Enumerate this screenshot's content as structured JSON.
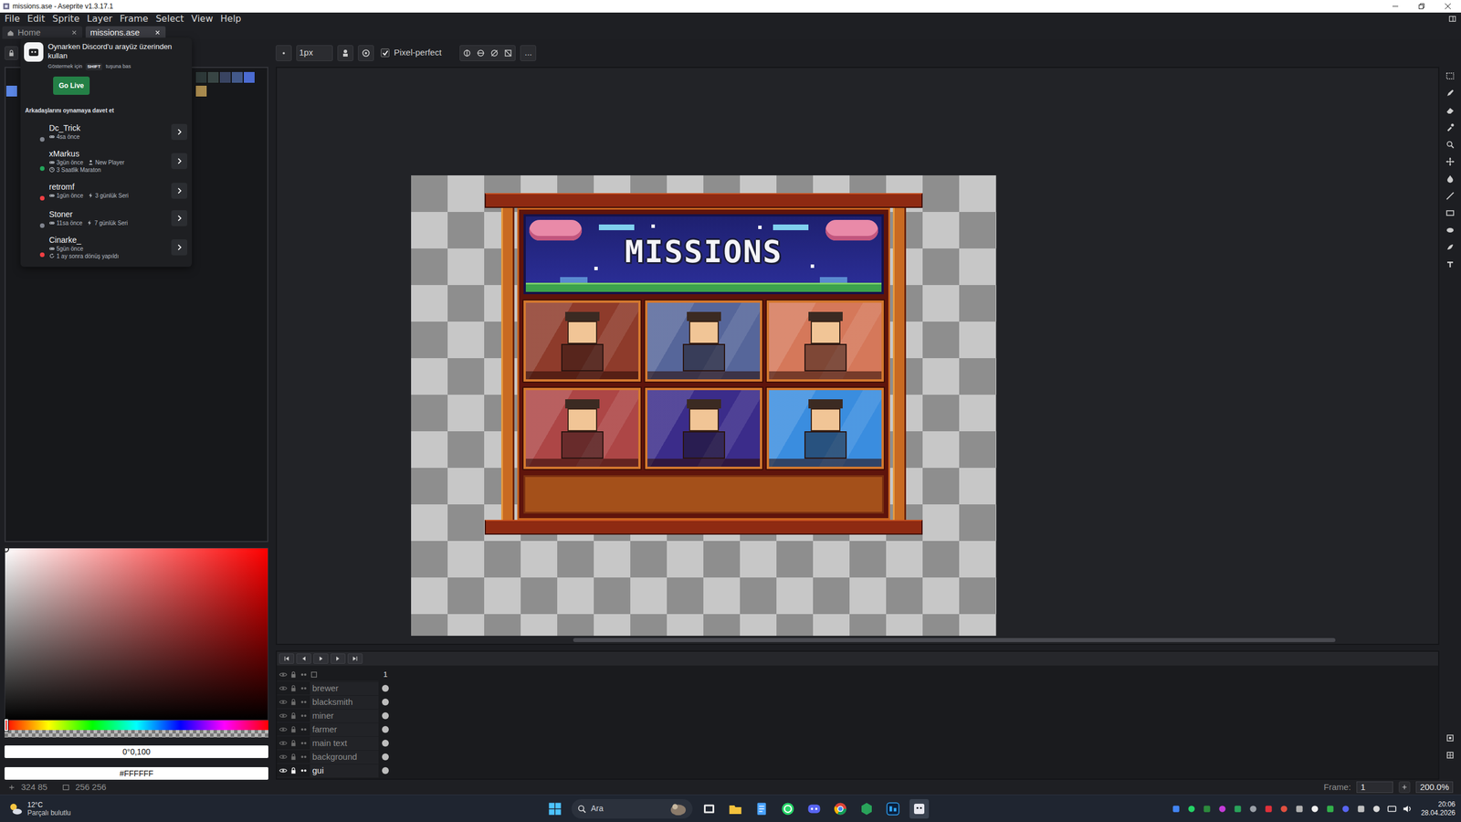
{
  "window": {
    "title": "missions.ase - Aseprite v1.3.17.1"
  },
  "menu": [
    "File",
    "Edit",
    "Sprite",
    "Layer",
    "Frame",
    "Select",
    "View",
    "Help"
  ],
  "tabs": [
    {
      "label": "Home",
      "selected": false
    },
    {
      "label": "missions.ase",
      "selected": true
    }
  ],
  "toolbar": {
    "brush_size": "1px",
    "pixel_perfect": {
      "label": "Pixel-perfect",
      "checked": true
    },
    "more": "..."
  },
  "palette": {
    "row1": [
      {
        "color": "#2d3838"
      },
      {
        "color": "#384544"
      },
      {
        "color": "#394461"
      },
      {
        "color": "#43598a"
      },
      {
        "color": "#4b6bd1"
      }
    ],
    "row2": [
      {
        "color": "#5b86e5"
      },
      {
        "color": "#a88a4e"
      }
    ]
  },
  "color": {
    "hue": 0,
    "hsv": "0°0,100",
    "hex": "#FFFFFF"
  },
  "sprite": {
    "banner": "MISSIONS",
    "cells": [
      {
        "color": "#8e3b2b"
      },
      {
        "color": "#56669a"
      },
      {
        "color": "#d5785a"
      },
      {
        "color": "#ad4646"
      },
      {
        "color": "#3b2c8a"
      },
      {
        "color": "#3a8ddf"
      }
    ]
  },
  "timeline": {
    "frame": "1",
    "layers": [
      {
        "name": "brewer",
        "selected": false
      },
      {
        "name": "blacksmith",
        "selected": false
      },
      {
        "name": "miner",
        "selected": false
      },
      {
        "name": "farmer",
        "selected": false
      },
      {
        "name": "main text",
        "selected": false
      },
      {
        "name": "background",
        "selected": false
      },
      {
        "name": "gui",
        "selected": true
      }
    ]
  },
  "status_bar": {
    "position": "324 85",
    "size": "256 256",
    "frame_label": "Frame:",
    "frame": "1",
    "zoom": "200.0%"
  },
  "overlay": {
    "title": "Oynarken Discord'u arayüz üzerinden kullan",
    "hint": {
      "before": "Göstermek için",
      "key": "SHIFT",
      "after": "tuşuna bas"
    },
    "go_live": "Go Live",
    "invite_title": "Arkadaşlarını oynamaya davet et",
    "friends": [
      {
        "name": "Dc_Trick",
        "avatar_color": "#8d8f7c",
        "status_color": "#80848e",
        "lines": [
          [
            {
              "kind": "played",
              "text": "4sa önce"
            }
          ]
        ]
      },
      {
        "name": "xMarkus",
        "avatar_color": "#e8a23c",
        "status_color": "#23a55a",
        "lines": [
          [
            {
              "kind": "played",
              "text": "3gün önce"
            },
            {
              "kind": "player",
              "text": "New Player"
            }
          ],
          [
            {
              "kind": "event",
              "text": "3 Saatlik Maraton"
            }
          ]
        ]
      },
      {
        "name": "retromf",
        "avatar_color": "#3a4a7a",
        "status_color": "#f23f43",
        "lines": [
          [
            {
              "kind": "played",
              "text": "1gün önce"
            },
            {
              "kind": "streak",
              "text": "3 günlük Seri"
            }
          ]
        ]
      },
      {
        "name": "Stoner",
        "avatar_color": "#3c3c3c",
        "status_color": "#80848e",
        "lines": [
          [
            {
              "kind": "played",
              "text": "11sa önce"
            },
            {
              "kind": "streak",
              "text": "7 günlük Seri"
            }
          ]
        ]
      },
      {
        "name": "Cinarke_",
        "avatar_color": "#c85a6a",
        "status_color": "#f23f43",
        "lines": [
          [
            {
              "kind": "played",
              "text": "5gün önce"
            }
          ],
          [
            {
              "kind": "return",
              "text": "1 ay sonra dönüş yapıldı"
            }
          ]
        ]
      }
    ]
  },
  "taskbar": {
    "temperature": "12°C",
    "weather": "Parçalı bulutlu",
    "search": "Ara",
    "time": "20:06",
    "date": "28.04.2026"
  }
}
